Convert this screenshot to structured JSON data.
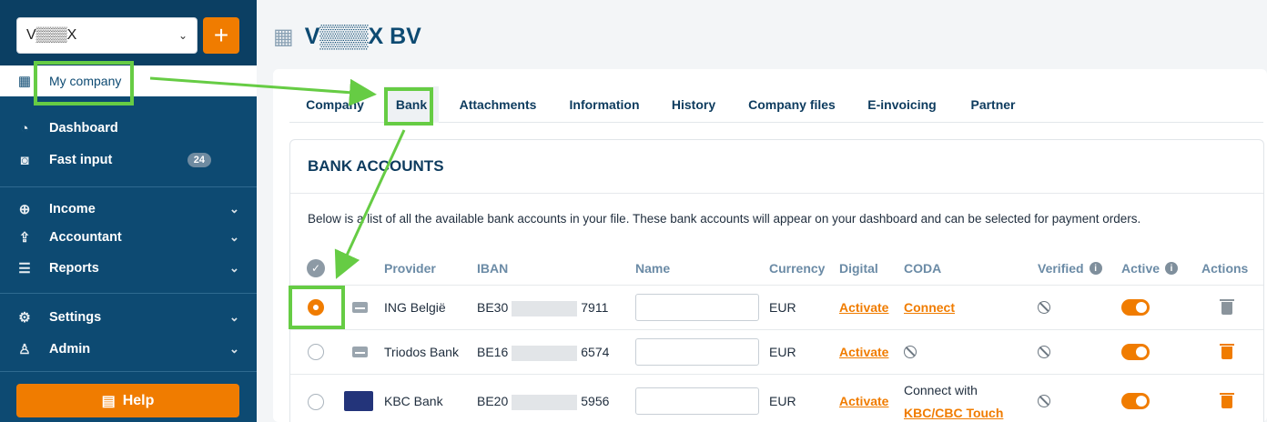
{
  "sidebar": {
    "company_select": "V▒▒▒X",
    "add_label": "+",
    "my_company": "My company",
    "items": [
      {
        "label": "Dashboard"
      },
      {
        "label": "Fast input",
        "badge": "24"
      },
      {
        "label": "Income"
      },
      {
        "label": "Accountant"
      },
      {
        "label": "Reports"
      },
      {
        "label": "Settings"
      },
      {
        "label": "Admin"
      }
    ],
    "help": "Help"
  },
  "main": {
    "title": "V▒▒▒X BV",
    "tabs": [
      "Company",
      "Bank",
      "Attachments",
      "Information",
      "History",
      "Company files",
      "E-invoicing",
      "Partner"
    ],
    "active_tab": "Bank",
    "section_title": "BANK ACCOUNTS",
    "description": "Below is a list of all the available bank accounts in your file. These bank accounts will appear on your dashboard and can be selected for payment orders.",
    "columns": [
      "Provider",
      "IBAN",
      "Name",
      "Currency",
      "Digital",
      "CODA",
      "Verified",
      "Active",
      "Actions"
    ],
    "rows": [
      {
        "provider": "ING België",
        "iban_start": "BE30",
        "iban_end": "7911",
        "currency": "EUR",
        "digital": "Activate",
        "coda": "Connect",
        "selected": true
      },
      {
        "provider": "Triodos Bank",
        "iban_start": "BE16",
        "iban_end": "6574",
        "currency": "EUR",
        "digital": "Activate",
        "coda": "",
        "selected": false
      },
      {
        "provider": "KBC Bank",
        "iban_start": "BE20",
        "iban_end": "5956",
        "currency": "EUR",
        "digital": "Activate",
        "coda_text": "Connect with",
        "coda": "KBC/CBC Touch",
        "selected": false
      }
    ]
  },
  "colors": {
    "sidebar": "#0d4a72",
    "accent": "#f07c00",
    "annotation": "#66cc44"
  }
}
